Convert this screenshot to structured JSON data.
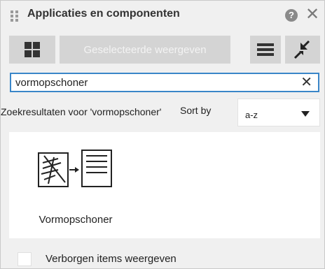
{
  "panel": {
    "title": "Applicaties en componenten"
  },
  "toolbar": {
    "view_selected_label": "Geselecteerde weergeven"
  },
  "search": {
    "value": "vormopschoner"
  },
  "results": {
    "label": "Zoekresultaten voor 'vormopschoner'",
    "sort_label": "Sort by",
    "sort_value": "a-z"
  },
  "items": [
    {
      "label": "Vormopschoner",
      "icon": "shape-cleaner-icon"
    }
  ],
  "footer": {
    "show_hidden_label": "Verborgen items weergeven",
    "show_hidden_checked": false
  },
  "colors": {
    "accent": "#3a86c8",
    "panel_bg": "#f0f0f0",
    "button_bg": "#d4d4d4"
  }
}
